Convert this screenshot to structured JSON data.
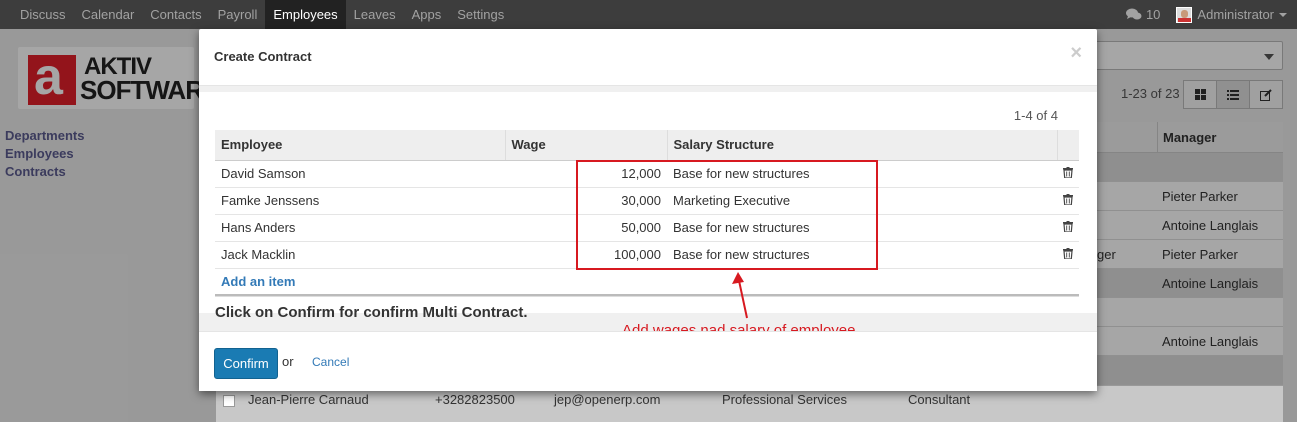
{
  "navbar": {
    "menu": [
      "Discuss",
      "Calendar",
      "Contacts",
      "Payroll",
      "Employees",
      "Leaves",
      "Apps",
      "Settings"
    ],
    "active": "Employees",
    "messages_count": "10",
    "user": "Administrator"
  },
  "background": {
    "logo": {
      "letter": "a",
      "line1": "AKTIV",
      "line2": "SOFTWARE"
    },
    "sidebar": [
      "Departments",
      "Employees",
      "Contracts"
    ],
    "pager": "1-23 of 23",
    "manager_header": "Manager",
    "managers": [
      "Pieter Parker",
      "Antoine Langlais",
      "Pieter Parker",
      "Antoine Langlais",
      "Antoine Langlais"
    ],
    "fragment": "ger",
    "bottom_row": {
      "name": "Jean-Pierre Carnaud",
      "phone": "+3282823500",
      "email": "jep@openerp.com",
      "department": "Professional Services",
      "job": "Consultant"
    }
  },
  "modal": {
    "title": "Create Contract",
    "close": "×",
    "pager": "1-4 of 4",
    "columns": [
      "Employee",
      "Wage",
      "Salary Structure"
    ],
    "rows": [
      {
        "employee": "David Samson",
        "wage": "12,000",
        "structure": "Base for new structures"
      },
      {
        "employee": "Famke Jenssens",
        "wage": "30,000",
        "structure": "Marketing Executive"
      },
      {
        "employee": "Hans Anders",
        "wage": "50,000",
        "structure": "Base for new structures"
      },
      {
        "employee": "Jack Macklin",
        "wage": "100,000",
        "structure": "Base for new structures"
      }
    ],
    "add_item": "Add an item",
    "note": "Click on Confirm for confirm Multi Contract.",
    "annotation": "Add wages nad salary of employee",
    "confirm": "Confirm",
    "or": "or",
    "cancel": "Cancel"
  },
  "colors": {
    "navbar": "#3d3d3d",
    "primary": "#1a7bb3",
    "annotation": "#d71920",
    "link": "#337ab7"
  }
}
